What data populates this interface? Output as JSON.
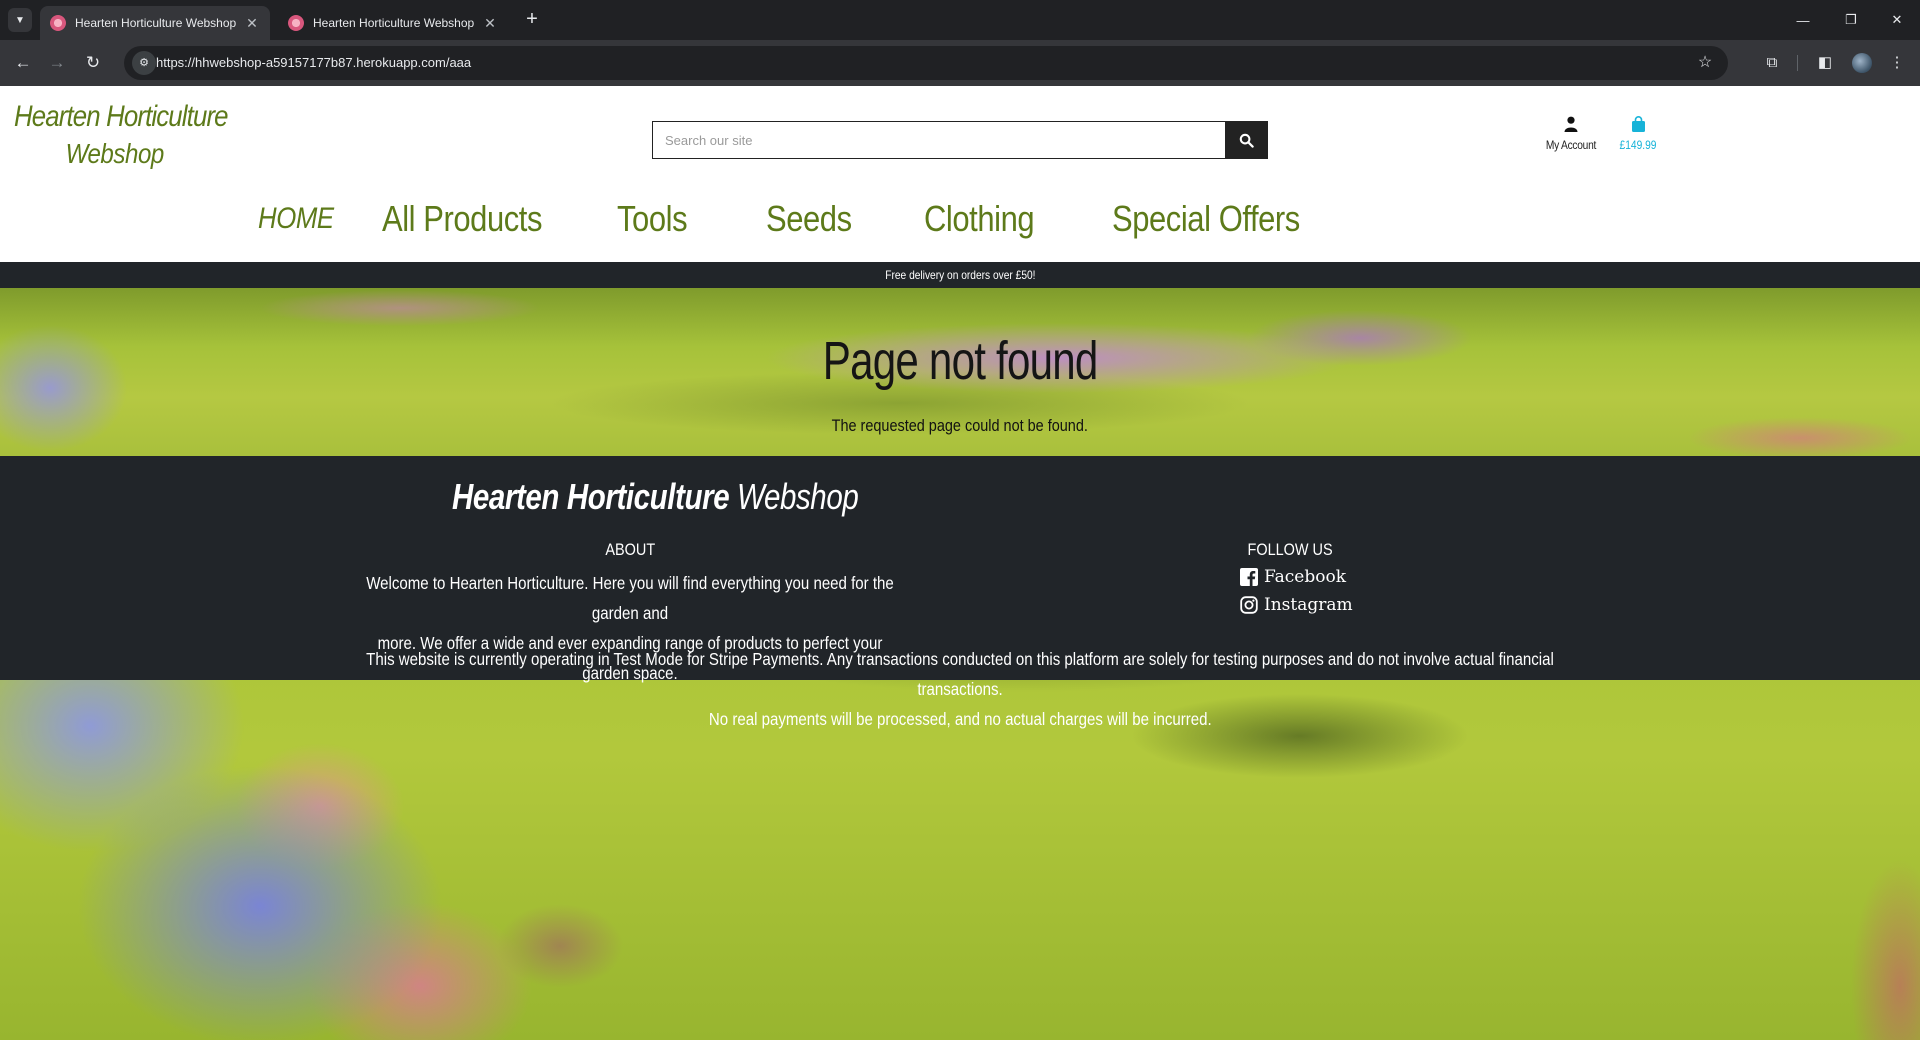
{
  "browser": {
    "tabs": [
      {
        "title": "Hearten Horticulture Webshop",
        "active": true
      },
      {
        "title": "Hearten Horticulture Webshop",
        "active": false
      }
    ],
    "url": "https://hhwebshop-a59157177b87.herokuapp.com/aaa",
    "icons": [
      "tab-search-icon",
      "back-arrow-icon",
      "forward-arrow-icon",
      "reload-icon",
      "site-info-icon",
      "bookmark-star-icon",
      "extensions-icon",
      "side-panel-icon",
      "profile-avatar",
      "more-menu-icon",
      "minimize-icon",
      "restore-icon",
      "close-window-icon",
      "new-tab-icon"
    ]
  },
  "header": {
    "logo_line1": "Hearten Horticulture",
    "logo_line2": "Webshop",
    "search_placeholder": "Search our site",
    "account_label": "My Account",
    "basket_total": "£149.99",
    "brand_color": "#5d7a1a",
    "basket_color": "#17b3d8"
  },
  "nav": {
    "home": "HOME",
    "items": [
      "All Products",
      "Tools",
      "Seeds",
      "Clothing",
      "Special Offers"
    ]
  },
  "banner": {
    "text": "Free delivery on orders over £50!"
  },
  "main": {
    "title": "Page not found",
    "subtitle": "The requested page could not be found."
  },
  "footer": {
    "brand_bold": "Hearten Horticulture",
    "brand_light": "Webshop",
    "about_heading": "ABOUT",
    "about_line1": "Welcome to Hearten Horticulture. Here you will find everything you need for the garden and",
    "about_line2": "more. We offer a wide and ever expanding range of products to perfect your garden space.",
    "follow_heading": "FOLLOW US",
    "facebook": "Facebook",
    "instagram": "Instagram",
    "note_line1": "This website is currently operating in Test Mode for Stripe Payments. Any transactions conducted on this platform are solely for testing purposes and do not involve actual financial transactions.",
    "note_line2": "No real payments will be processed, and no actual charges will be incurred."
  }
}
